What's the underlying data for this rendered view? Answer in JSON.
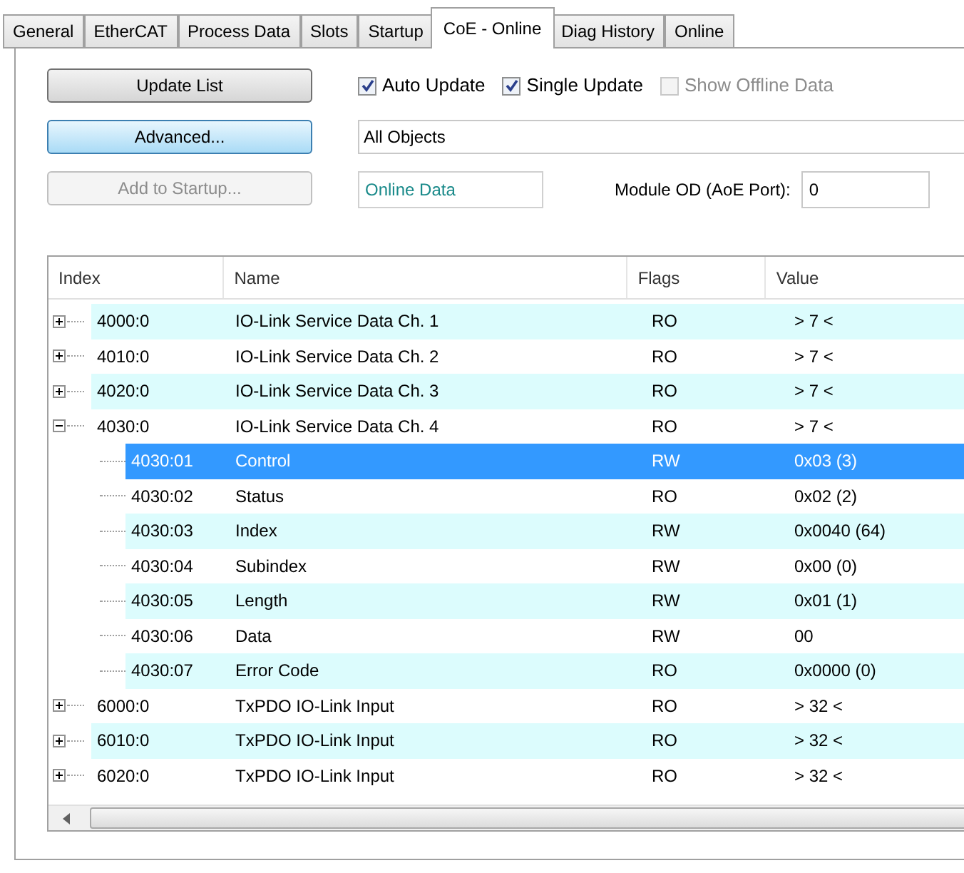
{
  "tabs": [
    {
      "label": "General",
      "selected": false
    },
    {
      "label": "EtherCAT",
      "selected": false
    },
    {
      "label": "Process Data",
      "selected": false
    },
    {
      "label": "Slots",
      "selected": false
    },
    {
      "label": "Startup",
      "selected": false
    },
    {
      "label": "CoE - Online",
      "selected": true
    },
    {
      "label": "Diag History",
      "selected": false
    },
    {
      "label": "Online",
      "selected": false
    }
  ],
  "buttons": [
    {
      "label": "Update List",
      "disabled": false,
      "focused": false
    },
    {
      "label": "Advanced...",
      "disabled": false,
      "focused": true
    },
    {
      "label": "Add to Startup...",
      "disabled": true,
      "focused": false
    }
  ],
  "checkboxes": [
    {
      "label": "Auto Update",
      "checked": true,
      "disabled": false
    },
    {
      "label": "Single Update",
      "checked": true,
      "disabled": false
    },
    {
      "label": "Show Offline Data",
      "checked": false,
      "disabled": true
    }
  ],
  "object_filter": {
    "value": "All Objects"
  },
  "data_source": {
    "value": "Online Data"
  },
  "module_od": {
    "label": "Module OD (AoE Port):",
    "value": "0"
  },
  "table": {
    "columns": [
      "Index",
      "Name",
      "Flags",
      "Value"
    ],
    "rows": [
      {
        "index": "4000:0",
        "name": "IO-Link Service Data Ch. 1",
        "flags": "RO",
        "value": "> 7 <",
        "expanded": false,
        "selected": false
      },
      {
        "index": "4010:0",
        "name": "IO-Link Service Data Ch. 2",
        "flags": "RO",
        "value": "> 7 <",
        "expanded": false,
        "selected": false
      },
      {
        "index": "4020:0",
        "name": "IO-Link Service Data Ch. 3",
        "flags": "RO",
        "value": "> 7 <",
        "expanded": false,
        "selected": false
      },
      {
        "index": "4030:0",
        "name": "IO-Link Service Data Ch. 4",
        "flags": "RO",
        "value": "> 7 <",
        "expanded": true,
        "selected": false,
        "children": [
          {
            "index": "4030:01",
            "name": "Control",
            "flags": "RW",
            "value": "0x03 (3)",
            "selected": true
          },
          {
            "index": "4030:02",
            "name": "Status",
            "flags": "RO",
            "value": "0x02 (2)",
            "selected": false
          },
          {
            "index": "4030:03",
            "name": "Index",
            "flags": "RW",
            "value": "0x0040 (64)",
            "selected": false
          },
          {
            "index": "4030:04",
            "name": "Subindex",
            "flags": "RW",
            "value": "0x00 (0)",
            "selected": false
          },
          {
            "index": "4030:05",
            "name": "Length",
            "flags": "RW",
            "value": "0x01 (1)",
            "selected": false
          },
          {
            "index": "4030:06",
            "name": "Data",
            "flags": "RW",
            "value": "00",
            "selected": false
          },
          {
            "index": "4030:07",
            "name": "Error Code",
            "flags": "RO",
            "value": "0x0000 (0)",
            "selected": false
          }
        ]
      },
      {
        "index": "6000:0",
        "name": "TxPDO IO-Link Input",
        "flags": "RO",
        "value": "> 32 <",
        "expanded": false,
        "selected": false
      },
      {
        "index": "6010:0",
        "name": "TxPDO IO-Link Input",
        "flags": "RO",
        "value": "> 32 <",
        "expanded": false,
        "selected": false
      },
      {
        "index": "6020:0",
        "name": "TxPDO IO-Link Input",
        "flags": "RO",
        "value": "> 32 <",
        "expanded": false,
        "selected": false
      }
    ]
  }
}
